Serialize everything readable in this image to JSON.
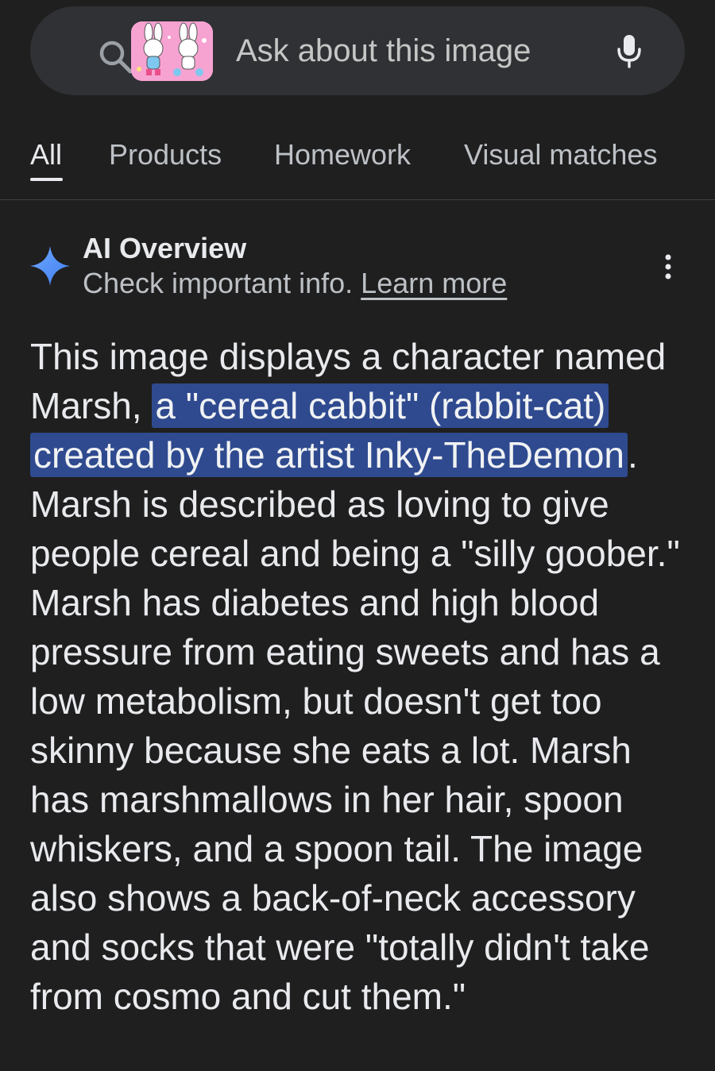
{
  "search": {
    "placeholder": "Ask about this image"
  },
  "tabs": [
    {
      "label": "All",
      "active": true
    },
    {
      "label": "Products"
    },
    {
      "label": "Homework"
    },
    {
      "label": "Visual matches"
    }
  ],
  "ai_overview": {
    "title": "AI Overview",
    "subtitle": "Check important info.",
    "learn_more": "Learn more",
    "text_before": "This image displays a character named Marsh, ",
    "text_highlight": "a \"cereal cabbit\" (rabbit-cat) created by the artist Inky-TheDemon",
    "text_after": ". Marsh is described as loving to give people cereal and being a \"silly goober.\" Marsh has diabetes and high blood pressure from eating sweets and has a low metabolism, but doesn't get too skinny because she eats a lot. Marsh has marshmallows in her hair, spoon whiskers, and a spoon tail. The image also shows a back-of-neck accessory and socks that were \"totally didn't take from cosmo and cut them.\""
  },
  "colors": {
    "background": "#1f1f1f",
    "search_bar": "#303134",
    "highlight": "#2f4a8f",
    "sparkle": "#4f8df5"
  },
  "icons": [
    "search-icon",
    "image-thumbnail",
    "mic-icon",
    "sparkle-icon",
    "more-vert-icon"
  ]
}
